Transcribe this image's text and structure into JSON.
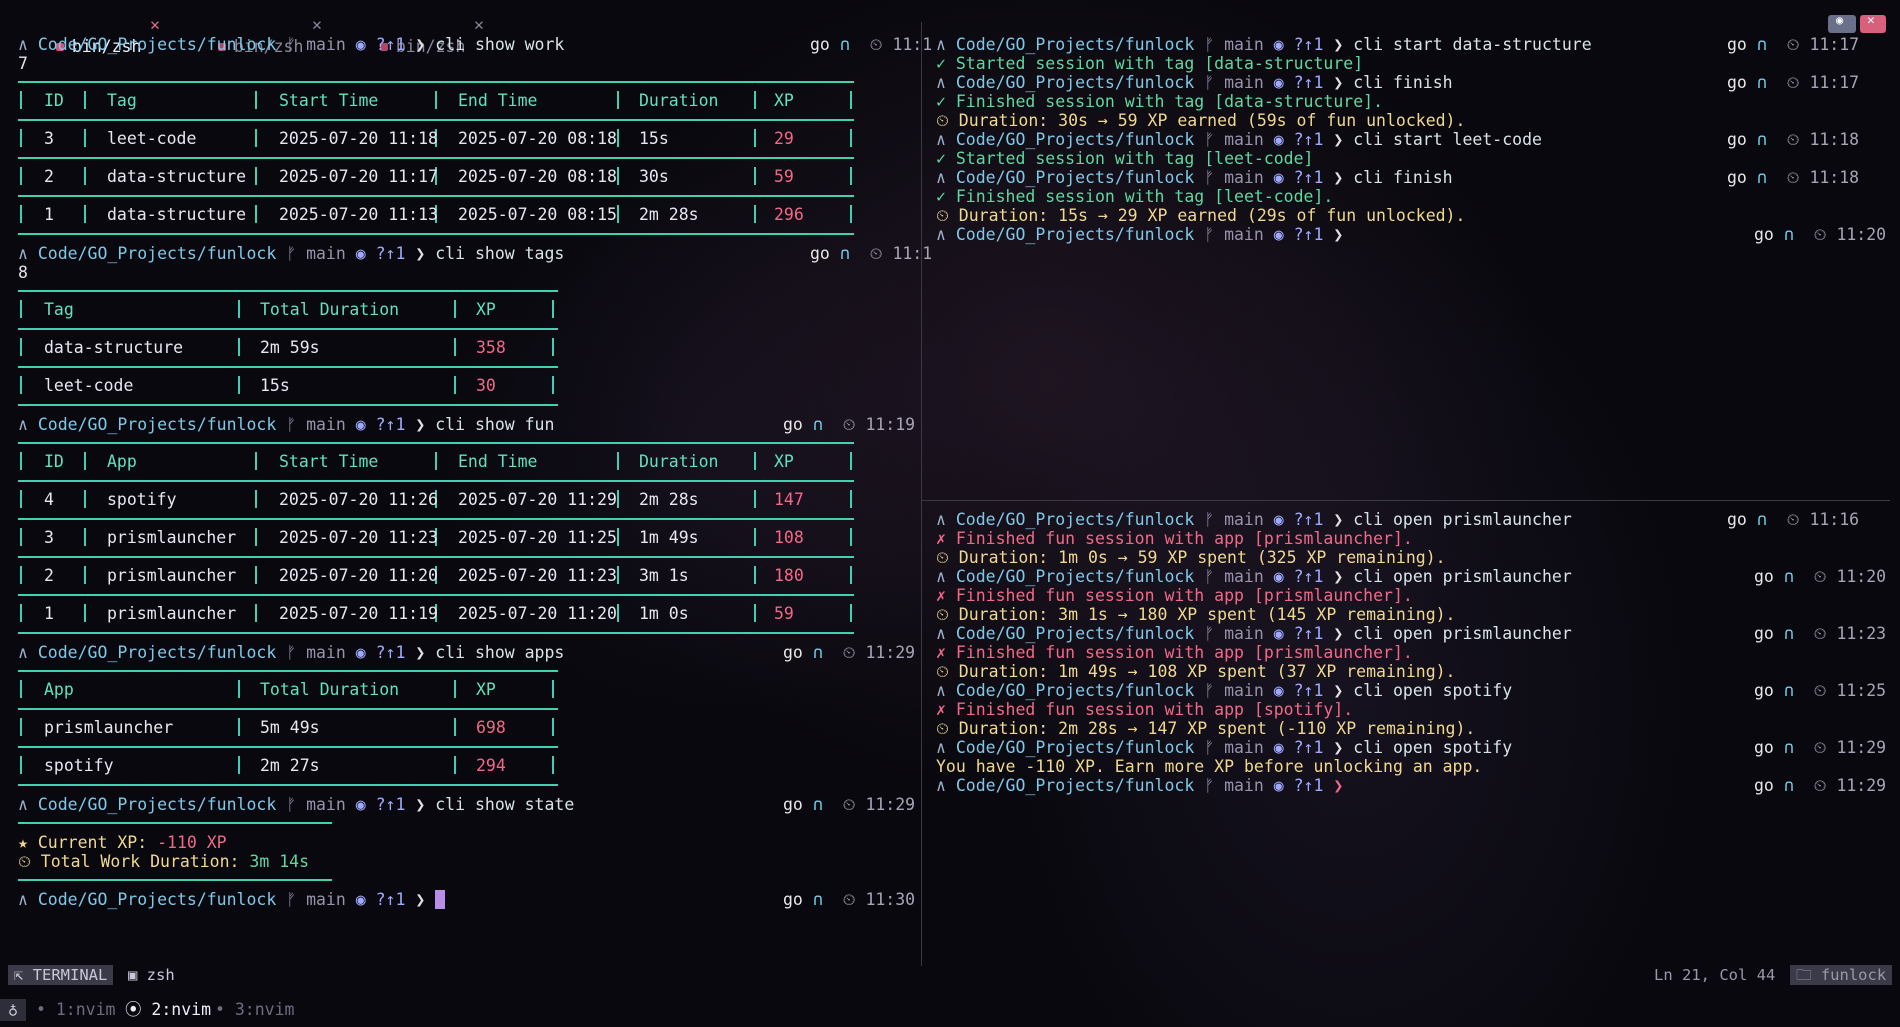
{
  "tabs": [
    {
      "label": "bin/zsh",
      "active": true
    },
    {
      "label": "bin/zsh",
      "active": false
    },
    {
      "label": "bin/zsh",
      "active": false
    }
  ],
  "close_glyph": "✕",
  "prompt": {
    "dir": "Code/GO_Projects/funlock",
    "branch": "ᚠ main",
    "status": "◉ ?↑1",
    "arrow": "❯",
    "go": "go",
    "nn": "∩",
    "clock": "⏲"
  },
  "left": {
    "cmd_work": "cli show work",
    "time_work": "11:1",
    "wrap_work": "7",
    "work_headers": [
      "ID",
      "Tag",
      "Start Time",
      "End Time",
      "Duration",
      "XP"
    ],
    "work_rows": [
      [
        "3",
        "leet-code",
        "2025-07-20 11:18",
        "2025-07-20 08:18",
        "15s",
        "29"
      ],
      [
        "2",
        "data-structure",
        "2025-07-20 11:17",
        "2025-07-20 08:18",
        "30s",
        "59"
      ],
      [
        "1",
        "data-structure",
        "2025-07-20 11:13",
        "2025-07-20 08:15",
        "2m 28s",
        "296"
      ]
    ],
    "cmd_tags": "cli show tags",
    "time_tags": "11:1",
    "wrap_tags": "8",
    "tags_headers": [
      "Tag",
      "Total Duration",
      "XP"
    ],
    "tags_rows": [
      [
        "data-structure",
        "2m 59s",
        "358"
      ],
      [
        "leet-code",
        "15s",
        "30"
      ]
    ],
    "cmd_fun": "cli show fun",
    "time_fun": "11:19",
    "fun_headers": [
      "ID",
      "App",
      "Start Time",
      "End Time",
      "Duration",
      "XP"
    ],
    "fun_rows": [
      [
        "4",
        "spotify",
        "2025-07-20 11:26",
        "2025-07-20 11:29",
        "2m 28s",
        "147"
      ],
      [
        "3",
        "prismlauncher",
        "2025-07-20 11:23",
        "2025-07-20 11:25",
        "1m 49s",
        "108"
      ],
      [
        "2",
        "prismlauncher",
        "2025-07-20 11:20",
        "2025-07-20 11:23",
        "3m 1s",
        "180"
      ],
      [
        "1",
        "prismlauncher",
        "2025-07-20 11:19",
        "2025-07-20 11:20",
        "1m 0s",
        "59"
      ]
    ],
    "cmd_apps": "cli show apps",
    "time_apps": "11:29",
    "apps_headers": [
      "App",
      "Total Duration",
      "XP"
    ],
    "apps_rows": [
      [
        "prismlauncher",
        "5m 49s",
        "698"
      ],
      [
        "spotify",
        "2m 27s",
        "294"
      ]
    ],
    "cmd_state": "cli show state",
    "time_state": "11:29",
    "state_xp_label": "★ Current XP: ",
    "state_xp_value": "-110 XP",
    "state_dur_label": "⏲ Total Work Duration: ",
    "state_dur_value": "3m 14s",
    "time_last": "11:30"
  },
  "top_right": {
    "lines": [
      {
        "type": "prompt",
        "cmd": "cli start data-structure",
        "time": "11:17"
      },
      {
        "type": "green",
        "text": "✓ Started session with tag [data-structure]"
      },
      {
        "type": "prompt",
        "cmd": "cli finish",
        "time": "11:17"
      },
      {
        "type": "green",
        "text": "✓ Finished session with tag [data-structure]."
      },
      {
        "type": "yellow",
        "text": "⏲ Duration: 30s → 59 XP earned (59s of fun unlocked)."
      },
      {
        "type": "prompt",
        "cmd": "cli start leet-code",
        "time": "11:18"
      },
      {
        "type": "green",
        "text": "✓ Started session with tag [leet-code]"
      },
      {
        "type": "prompt",
        "cmd": "cli finish",
        "time": "11:18"
      },
      {
        "type": "green",
        "text": "✓ Finished session with tag [leet-code]."
      },
      {
        "type": "yellow",
        "text": "⏲ Duration: 15s → 29 XP earned (29s of fun unlocked)."
      },
      {
        "type": "prompt",
        "cmd": "",
        "time": "11:20"
      }
    ]
  },
  "bottom_right": {
    "lines": [
      {
        "type": "prompt",
        "cmd": "cli open prismlauncher",
        "time": "11:16"
      },
      {
        "type": "red",
        "text": "✗ Finished fun session with app [prismlauncher]."
      },
      {
        "type": "yellow",
        "text": "⏲ Duration: 1m 0s → 59 XP spent (325 XP remaining)."
      },
      {
        "type": "prompt",
        "cmd": "cli open prismlauncher",
        "time": "11:20"
      },
      {
        "type": "red",
        "text": "✗ Finished fun session with app [prismlauncher]."
      },
      {
        "type": "yellow",
        "text": "⏲ Duration: 3m 1s → 180 XP spent (145 XP remaining)."
      },
      {
        "type": "prompt",
        "cmd": "cli open prismlauncher",
        "time": "11:23"
      },
      {
        "type": "red",
        "text": "✗ Finished fun session with app [prismlauncher]."
      },
      {
        "type": "yellow",
        "text": "⏲ Duration: 1m 49s → 108 XP spent (37 XP remaining)."
      },
      {
        "type": "prompt",
        "cmd": "cli open spotify",
        "time": "11:25"
      },
      {
        "type": "red",
        "text": "✗ Finished fun session with app [spotify]."
      },
      {
        "type": "yellow",
        "text": "⏲ Duration: 2m 28s → 147 XP spent (-110 XP remaining)."
      },
      {
        "type": "prompt",
        "cmd": "cli open spotify",
        "time": "11:29"
      },
      {
        "type": "yellowplain",
        "text": "You have -110 XP. Earn more XP before unlocking an app."
      },
      {
        "type": "prompt-red",
        "cmd": "",
        "time": "11:29"
      }
    ]
  },
  "statusbar": {
    "terminal_label": "⇱ TERMINAL",
    "shell_label": "▣ zsh",
    "position": "Ln 21, Col 44",
    "project": "🗀 funlock"
  },
  "tmux": {
    "icon": "♁",
    "windows": [
      {
        "label": "• 1:nvim",
        "active": false
      },
      {
        "label": "⦿ 2:nvim",
        "active": true
      },
      {
        "label": "• 3:nvim",
        "active": false
      }
    ]
  },
  "colors": {
    "accent": "#43d0b0",
    "xp": "#f36889",
    "dir": "#7fc8e8",
    "success": "#5fd7a0",
    "warn": "#f0d890"
  }
}
